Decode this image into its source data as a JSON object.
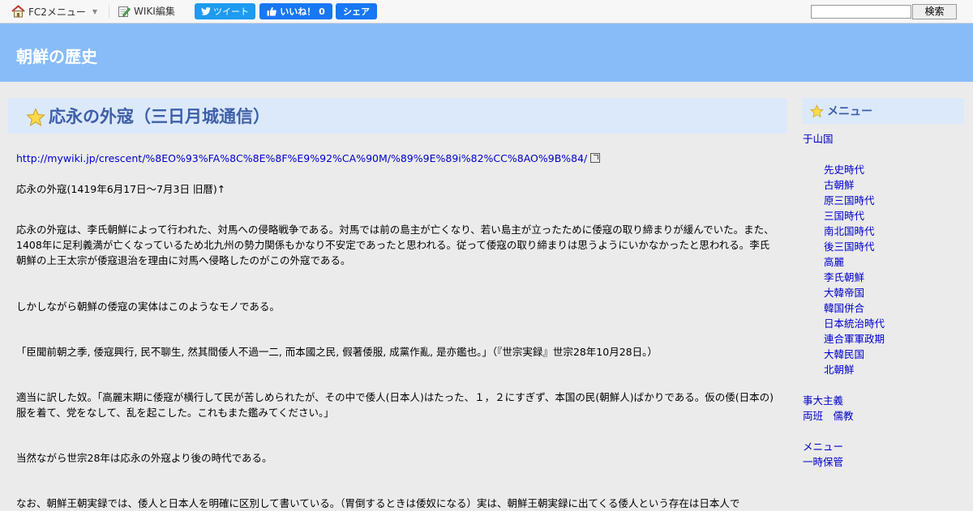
{
  "topbar": {
    "fc2_menu_label": "FC2メニュー",
    "wiki_edit_label": "WIKI編集",
    "tweet_label": "ツイート",
    "like_label": "いいね！ 0",
    "share_label": "シェア",
    "search_value": "",
    "search_button": "検索"
  },
  "header": {
    "site_title": "朝鮮の歴史"
  },
  "page": {
    "title": "応永の外寇（三日月城通信）",
    "link": "http://mywiki.jp/crescent/%8EO%93%FA%8C%8E%8F%E9%92%CA%90M/%89%9E%89i%82%CC%8AO%9B%84/",
    "paragraphs": [
      "応永の外寇(1419年6月17日～7月3日 旧暦)↑",
      "応永の外寇は、李氏朝鮮によって行われた、対馬への侵略戦争である。対馬では前の島主が亡くなり、若い島主が立ったために倭寇の取り締まりが緩んでいた。また、1408年に足利義満が亡くなっているため北九州の勢力関係もかなり不安定であったと思われる。従って倭寇の取り締まりは思うようにいかなかったと思われる。李氏朝鮮の上王太宗が倭寇退治を理由に対馬へ侵略したのがこの外寇である。",
      "しかしながら朝鮮の倭寇の実体はこのようなモノである。",
      "「臣聞前朝之季, 倭寇興行, 民不聊生, 然其間倭人不過一二, 而本國之民, 假著倭服, 成黨作亂, 是亦鑑也。」（『世宗実録』世宗28年10月28日。）",
      "適当に訳した奴。「高麗末期に倭寇が横行して民が苦しめられたが、その中で倭人(日本人)はたった、１，２にすぎず、本国の民(朝鮮人)ばかりである。仮の倭(日本の)服を着て、党をなして、乱を起こした。これもまた鑑みてください。」",
      "当然ながら世宗28年は応永の外寇より後の時代である。",
      "なお、朝鮮王朝実録では、倭人と日本人を明確に区別して書いている。（胃倒するときは倭奴になる）実は、朝鮮王朝実録に出てくる倭人という存在は日本人で"
    ]
  },
  "sidebar": {
    "title": "メニュー",
    "top_link": "于山国",
    "era_links": [
      "先史時代",
      "古朝鮮",
      "原三国時代",
      "三国時代",
      "南北国時代",
      "後三国時代",
      "高麗",
      "李氏朝鮮",
      "大韓帝国",
      "韓国併合",
      "日本統治時代",
      "連合軍軍政期",
      "大韓民国",
      "北朝鮮"
    ],
    "misc_links": [
      "事大主義",
      "両班　儒教"
    ],
    "bottom_links": [
      "メニュー",
      "一時保管"
    ]
  }
}
